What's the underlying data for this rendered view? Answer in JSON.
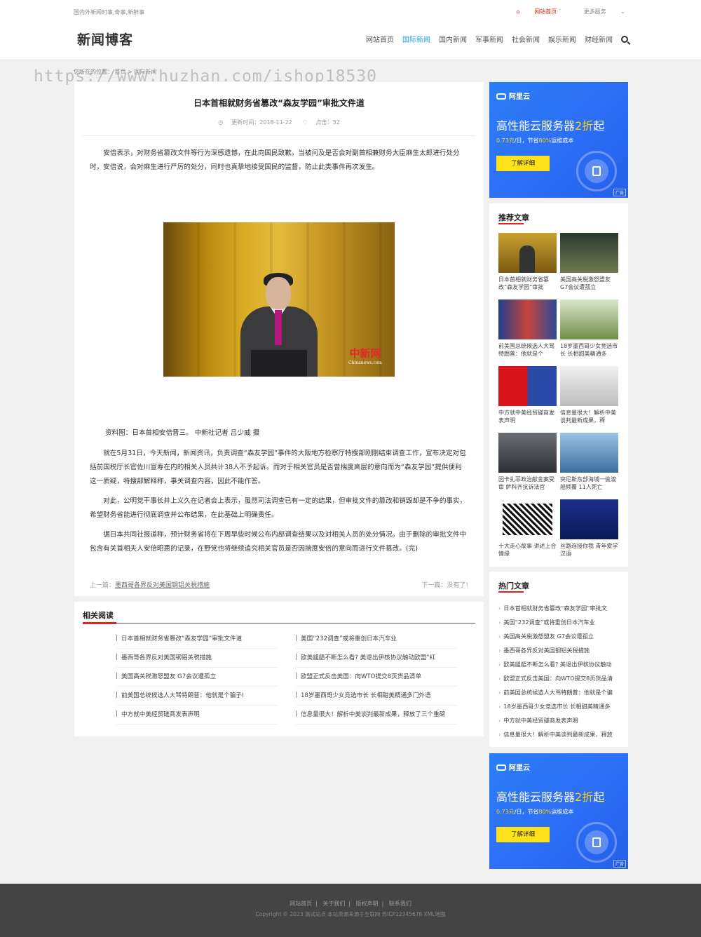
{
  "header": {
    "tagline": "国内外新闻时事,奇事,新鲜事",
    "top_home": "网站首页",
    "top_more": "更多服务",
    "logo": "新闻博客",
    "nav": [
      "网站首页",
      "国际新闻",
      "国内新闻",
      "军事新闻",
      "社会新闻",
      "娱乐新闻",
      "财经新闻"
    ],
    "nav_active_index": 1,
    "accent": "#1ea0e0"
  },
  "watermark": "https://www.huzhan.com/ishop18530",
  "breadcrumb": "您所在的位置： 首页 > 国际新闻",
  "article": {
    "title": "日本首相就财务省篡改“森友学园”审批文件道",
    "updated": "更新时间：2018-11-22",
    "clicks": "点击：32",
    "p1": "安倍表示，对财务省篡改文件等行为深感遗憾，在此向国民致歉。当被问及是否会对副首相兼财务大臣麻生太郎进行处分时，安倍说，会对麻生进行严厉的处分，同时也真挚地接受国民的监督，防止此类事件再次发生。",
    "photo_logo": "中新网",
    "photo_logo_sub": "Chinanews.com",
    "caption": "资料图：日本首相安倍晋三。 中新社记者 吕少威 摄",
    "p2": "就在5月31日，今天新闻，新闻资讯，负责调查“森友学园”事件的大阪地方检察厅特搜部刚刚结束调查工作，宣布决定对包括前国税厅长官佐川宣寿在内的相关人员共计38人不予起诉。而对于相关官员是否曾揣度高层的意向而为“森友学园”提供便利这一质疑，特搜部解释称，事关调查内容，因此不能作答。",
    "p3": "对此，公明党干事长井上义久在记者会上表示，虽然司法调查已有一定的结果，但审批文件的篡改和销毁却是不争的事实，希望财务省能进行彻底调查并公布结果，在此基础上明确责任。",
    "p4": "据日本共同社报道称，预计财务省将在下周早些时候公布内部调查结果以及对相关人员的处分情况。由于删除的审批文件中包含有关首相夫人安倍昭惠的记录，在野党也将继续追究相关官员是否因揣度安倍的意向而进行文件篡改。(完)",
    "prev_label": "上一篇：",
    "prev_link": "墨西哥各界反对美国钢铝关税措施",
    "next_label": "下一篇：",
    "next_link": "没有了!"
  },
  "related": {
    "title": "相关阅读",
    "left": [
      "日本首相就财务省篡改“森友学园”审批文件道",
      "墨西哥各界反对美国钢铝关税措施",
      "美国高关税激怒盟友 G7会议遭孤立",
      "前美国总统候选人大骂特朗普：他就是个骗子!",
      "中方就中美经贸磋商发表声明"
    ],
    "right": [
      "美国“232调查”或将重创日本汽车业",
      "欧美龃龉不断怎么看? 美退出伊核协议触动欧盟“红",
      "欧盟正式反击美国：向WTO提交8页货品清单",
      "18岁墨西哥少女竞选市长 长相甜美精通多门外语",
      "信息量很大！解析中美谈判最新成果，释放了三个重磅"
    ]
  },
  "ad": {
    "brand": "阿里云",
    "headline_pre": "高性能云服务器",
    "headline_hl": "2折",
    "headline_post": "起",
    "sub_pre": "0.73元",
    "sub_mid": "/日，节省",
    "sub_hl": "80%",
    "sub_post": "运维成本",
    "button": "了解详细",
    "tag": "广告"
  },
  "recommend": {
    "title": "推荐文章",
    "items": [
      {
        "t": "日本首相就财务省篡改“森友学园”审批"
      },
      {
        "t": "美国高关税激怒盟友 G7会议遭孤立"
      },
      {
        "t": "前美国总统候选人大骂特朗普：他就是个"
      },
      {
        "t": "18岁墨西哥少女竞选市长 长相甜美精通多"
      },
      {
        "t": "中方就中美经贸磋商发表声明"
      },
      {
        "t": "信息量很大！解析中美谈判最新成果，释"
      },
      {
        "t": "因卡扎菲政治献金案受审 萨科齐抗诉法官"
      },
      {
        "t": "突尼斯东部海域一偷渡船倾覆 11人死亡"
      },
      {
        "t": "十大走心故事 讲述上合情缘"
      },
      {
        "t": "丝路连接你我 青年爱学汉语"
      }
    ]
  },
  "hot": {
    "title": "热门文章",
    "items": [
      "日本首相就财务省篡改“森友学园”审批文",
      "美国“232调查”或将重创日本汽车业",
      "美国高关税激怒盟友 G7会议遭孤立",
      "墨西哥各界反对美国钢铝关税措施",
      "欧美龃龉不断怎么看? 美退出伊核协议触动",
      "欧盟正式反击美国：向WTO提交8页货品清",
      "前美国总统候选人大骂特朗普：他就是个骗",
      "18岁墨西哥少女竞选市长 长相甜美精通多",
      "中方就中美经贸磋商发表声明",
      "信息量很大！解析中美谈判最新成果，释放"
    ]
  },
  "footer": {
    "links": [
      "网站首页",
      "关于我们",
      "版权声明",
      "联系我们"
    ],
    "copyright": "Copyright © 2023 测试站点 本站资源来源于互联网 苏ICP12345678 XML地图"
  }
}
